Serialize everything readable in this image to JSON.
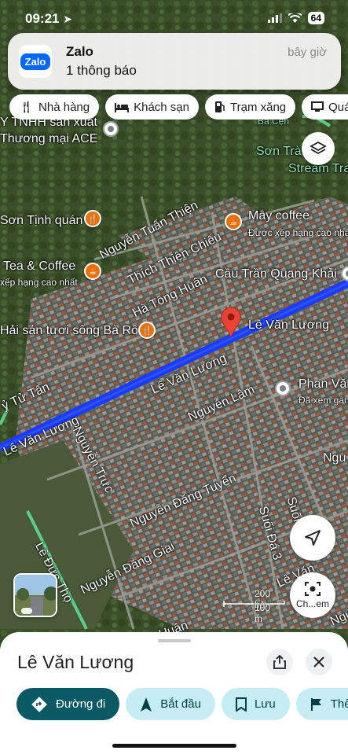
{
  "status_bar": {
    "time": "09:21",
    "battery": "64"
  },
  "notification": {
    "app_icon_text": "Zalo",
    "title": "Zalo",
    "body": "1 thông báo",
    "time": "bây giờ"
  },
  "chips": [
    {
      "label": "Nhà hàng",
      "icon": "fork-knife-icon"
    },
    {
      "label": "Khách sạn",
      "icon": "bed-icon"
    },
    {
      "label": "Trạm xăng",
      "icon": "gas-pump-icon"
    },
    {
      "label": "Quá",
      "icon": "shop-icon"
    }
  ],
  "map": {
    "labels": {
      "ace_1": "Y TNHH sản xuất",
      "ace_2": "Thương mại ACE",
      "sontra_1": "Sơn Trà Ca",
      "sontra_2": "Stream Tra",
      "son_tinh_quan": "Sơn Tịnh quán",
      "may_coffee": "Mây coffee",
      "may_coffee_rating": "Được xếp hạng cao nhất",
      "tea_coffee": "Tea & Coffee",
      "tea_coffee_rating": "xếp hạng cao nhất",
      "nguyen_tuan_thien": "Nguyễn Tuấn Thiện",
      "thich_thien_chieu": "Thích Thiện Chiếu",
      "ha_tong_huan": "Hà Tông Huân",
      "cau_tran_quang_khai": "Cầu Trần Quang Khải",
      "hai_san": "Hải sản tươi sống Bà Rô",
      "le_van_luong_pin": "Lê Văn Lương",
      "le_van_luong_road_1": "Lê Văn Lương",
      "le_van_luong_road_2": "Lê Văn Lương",
      "y_tu_tan": "ỷ Tử Tấn",
      "nguyen_lam": "Nguyễn Lâm",
      "phan_van": "Phan Văn",
      "phan_van_sub": "Đã xem gần",
      "nguyen_truc": "Nguyễn Trực",
      "ngu_right": "Ngu",
      "nguyen_dang_tuyen": "Nguyễn Đăng Tuyển",
      "suoi_da_3": "Suối Đá 3",
      "suoi_right": "Suối",
      "nguyen_dang_giai": "Nguyễn Đăng Giai",
      "le_duc_tho": "Lê Đức Thọ",
      "le_van_right": "Lê Văn",
      "ngu_bottom": "Ngu",
      "huan_bottom": "Huân",
      "ba_cen": "Bà Cẹn"
    },
    "scale": {
      "top": "200 bộ",
      "bottom": "100 m"
    },
    "lens_label": "Ch...em"
  },
  "sheet": {
    "title": "Lê Văn Lương",
    "actions": [
      {
        "label": "Đường đi",
        "icon": "directions-icon",
        "style": "primary"
      },
      {
        "label": "Bắt đầu",
        "icon": "navigation-arrow-icon",
        "style": "secondary"
      },
      {
        "label": "Lưu",
        "icon": "bookmark-icon",
        "style": "secondary"
      },
      {
        "label": "Thê",
        "icon": "flag-icon",
        "style": "secondary"
      }
    ]
  },
  "colors": {
    "route": "#1a3cff",
    "primary_button": "#0b5965",
    "secondary_button": "#c6ecf5",
    "poi_orange": "#e8710a"
  }
}
